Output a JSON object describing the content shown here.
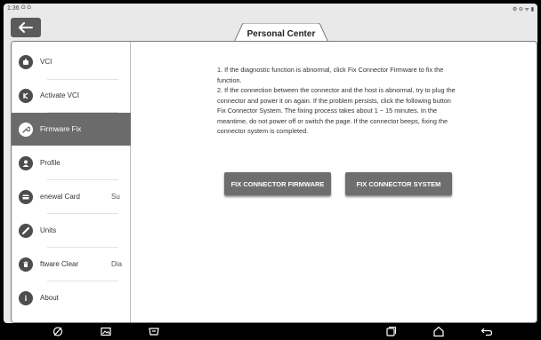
{
  "status_bar": {
    "time": "1:36",
    "left_icons": "G G",
    "right_icons": "⚙ ⊖ ᯤ ▮"
  },
  "header": {
    "title": "Personal Center"
  },
  "sidebar": {
    "items": [
      {
        "label": "VCI",
        "extra": "",
        "icon": "vci-icon",
        "active": false
      },
      {
        "label": "Activate VCI",
        "extra": "",
        "icon": "activate-icon",
        "active": false
      },
      {
        "label": "Firmware Fix",
        "extra": "",
        "icon": "wrench-icon",
        "active": true
      },
      {
        "label": "Profile",
        "extra": "",
        "icon": "profile-icon",
        "active": false
      },
      {
        "label": "enewal Card",
        "extra": "Su",
        "icon": "card-icon",
        "active": false
      },
      {
        "label": "Units",
        "extra": "",
        "icon": "ruler-icon",
        "active": false
      },
      {
        "label": "ftware Clear",
        "extra": "Dia",
        "icon": "trash-icon",
        "active": false
      },
      {
        "label": "About",
        "extra": "",
        "icon": "info-icon",
        "active": false
      }
    ]
  },
  "main": {
    "instructions": "1. If the diagnostic function is abnormal, click Fix Connector Firmware to fix the function.\n2. If the connection between the connector and the host is abnormal, try to plug the connector and power it on again. If the problem persists, click the following button Fix Connector System. The fixing process takes about 1 ~ 15 minutes. In the meantime, do not power off or switch the page. If the connector beeps, fixing the connector system is completed.",
    "fix_firmware_label": "FIX CONNECTOR FIRMWARE",
    "fix_system_label": "FIX CONNECTOR SYSTEM"
  },
  "colors": {
    "active_bg": "#6b6b6b",
    "button_bg": "#6e6e6e",
    "back_button_bg": "#5a5a5a"
  }
}
